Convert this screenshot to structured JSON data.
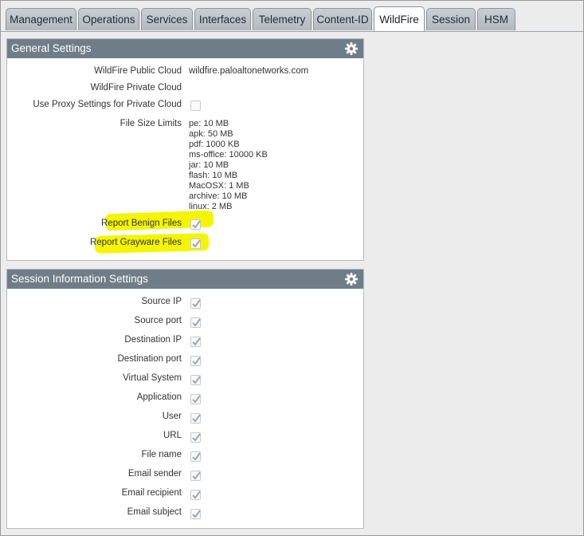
{
  "tabs": [
    {
      "label": "Management"
    },
    {
      "label": "Operations"
    },
    {
      "label": "Services"
    },
    {
      "label": "Interfaces"
    },
    {
      "label": "Telemetry"
    },
    {
      "label": "Content-ID"
    },
    {
      "label": "WildFire",
      "active": true
    },
    {
      "label": "Session"
    },
    {
      "label": "HSM"
    }
  ],
  "general": {
    "title": "General Settings",
    "public_cloud_label": "WildFire Public Cloud",
    "public_cloud_value": "wildfire.paloaltonetworks.com",
    "private_cloud_label": "WildFire Private Cloud",
    "proxy_label": "Use Proxy Settings for Private Cloud",
    "proxy_checked": false,
    "size_limits_label": "File Size Limits",
    "size_limits": [
      "pe: 10 MB",
      "apk: 50 MB",
      "pdf: 1000 KB",
      "ms-office: 10000 KB",
      "jar: 10 MB",
      "flash: 10 MB",
      "MacOSX: 1 MB",
      "archive: 10 MB",
      "linux: 2 MB"
    ],
    "benign_label": "Report Benign Files",
    "benign_checked": true,
    "grayware_label": "Report Grayware Files",
    "grayware_checked": true
  },
  "session": {
    "title": "Session Information Settings",
    "fields": [
      {
        "label": "Source IP",
        "checked": true
      },
      {
        "label": "Source port",
        "checked": true
      },
      {
        "label": "Destination IP",
        "checked": true
      },
      {
        "label": "Destination port",
        "checked": true
      },
      {
        "label": "Virtual System",
        "checked": true
      },
      {
        "label": "Application",
        "checked": true
      },
      {
        "label": "User",
        "checked": true
      },
      {
        "label": "URL",
        "checked": true
      },
      {
        "label": "File name",
        "checked": true
      },
      {
        "label": "Email sender",
        "checked": true
      },
      {
        "label": "Email recipient",
        "checked": true
      },
      {
        "label": "Email subject",
        "checked": true
      }
    ]
  },
  "colors": {
    "header": "#6f7d88",
    "highlight": "#f4f500",
    "check": "#9aa7b0"
  }
}
